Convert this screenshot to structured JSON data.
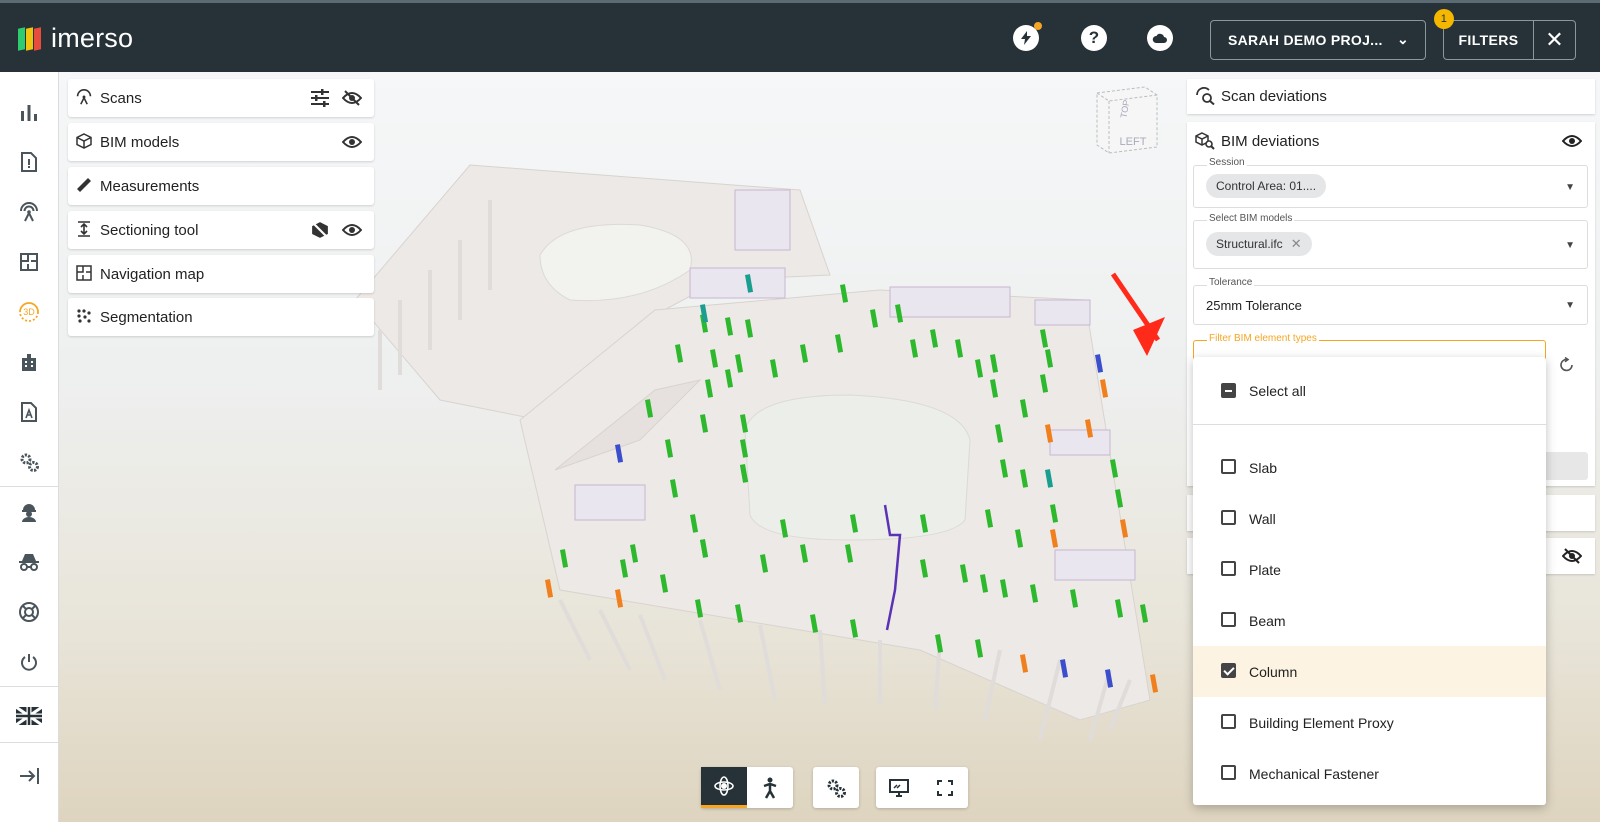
{
  "app": {
    "name": "imerso"
  },
  "topbar": {
    "icons": [
      "lightning-icon",
      "help-icon",
      "cloud-icon"
    ],
    "project_label": "SARAH DEMO PROJ...",
    "filters_label": "FILTERS",
    "filters_badge": "1"
  },
  "rail": {
    "items": [
      "chart-icon",
      "report-icon",
      "scan-icon",
      "floorplan-icon",
      "3d-view-icon",
      "building-icon",
      "document-icon",
      "settings-icon",
      "worker-icon",
      "incognito-icon",
      "support-icon",
      "power-icon",
      "language-flag-icon",
      "collapse-icon"
    ],
    "3d_label": "3D"
  },
  "tools": [
    {
      "label": "Scans"
    },
    {
      "label": "BIM models"
    },
    {
      "label": "Measurements"
    },
    {
      "label": "Sectioning tool"
    },
    {
      "label": "Navigation map"
    },
    {
      "label": "Segmentation"
    }
  ],
  "viewcube": {
    "top_label": "TOP",
    "left_label": "LEFT"
  },
  "right_panel": {
    "scan_deviations": "Scan deviations",
    "bim_deviations": "BIM deviations",
    "session_label": "Session",
    "session_value": "Control Area: 01....",
    "select_bim_label": "Select BIM models",
    "select_bim_chip": "Structural.ifc",
    "tolerance_label": "Tolerance",
    "tolerance_value": "25mm Tolerance",
    "filter_label": "Filter BIM element types"
  },
  "dropdown": {
    "select_all": "Select all",
    "items": [
      {
        "label": "Slab",
        "checked": false
      },
      {
        "label": "Wall",
        "checked": false
      },
      {
        "label": "Plate",
        "checked": false
      },
      {
        "label": "Beam",
        "checked": false
      },
      {
        "label": "Column",
        "checked": true
      },
      {
        "label": "Building Element Proxy",
        "checked": false
      },
      {
        "label": "Mechanical Fastener",
        "checked": false
      }
    ]
  },
  "colors": {
    "topbar": "#263238",
    "accent": "#f5a623",
    "column_ok": "#2db82d",
    "column_warn": "#f07f1e",
    "column_info": "#3b4fcc",
    "annotation_arrow": "#ff2a1a"
  }
}
